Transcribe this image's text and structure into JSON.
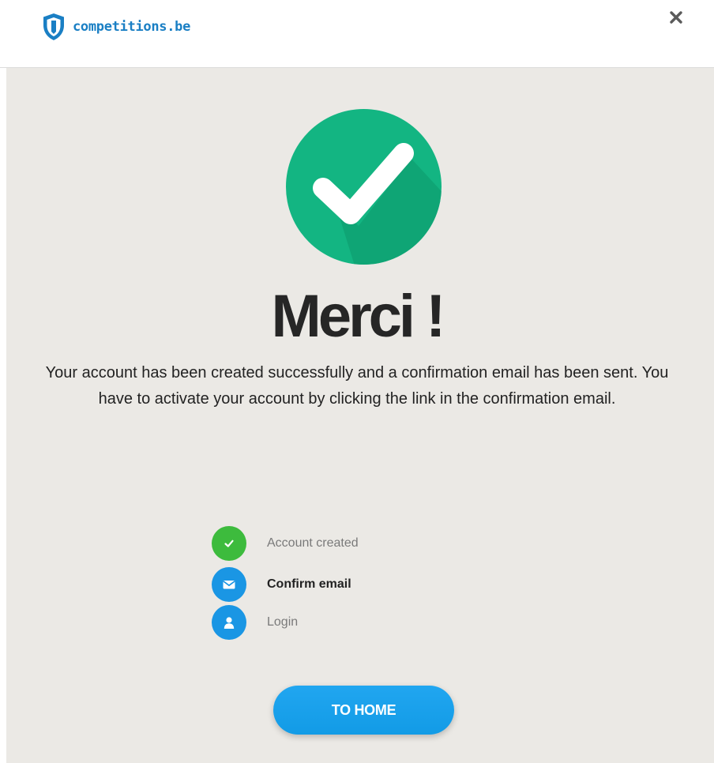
{
  "header": {
    "logo_text": "competitions.be",
    "close_label": "×"
  },
  "main": {
    "title": "Merci !",
    "message": "Your account has been created successfully and a confirmation email has been sent. You have to activate your account by clicking the link in the confirmation email.",
    "steps": [
      {
        "label": "Account created",
        "icon": "check-icon",
        "state": "done"
      },
      {
        "label": "Confirm email",
        "icon": "envelope-icon",
        "state": "current"
      },
      {
        "label": "Login",
        "icon": "user-icon",
        "state": "pending"
      }
    ],
    "home_button": "TO HOME"
  },
  "colors": {
    "brand_blue": "#1a7fc4",
    "success_green": "#13b582",
    "step_done_green": "#3dbb3d",
    "step_blue": "#1a96e4",
    "button_blue": "#1da1f2",
    "background": "#ebe9e5"
  }
}
